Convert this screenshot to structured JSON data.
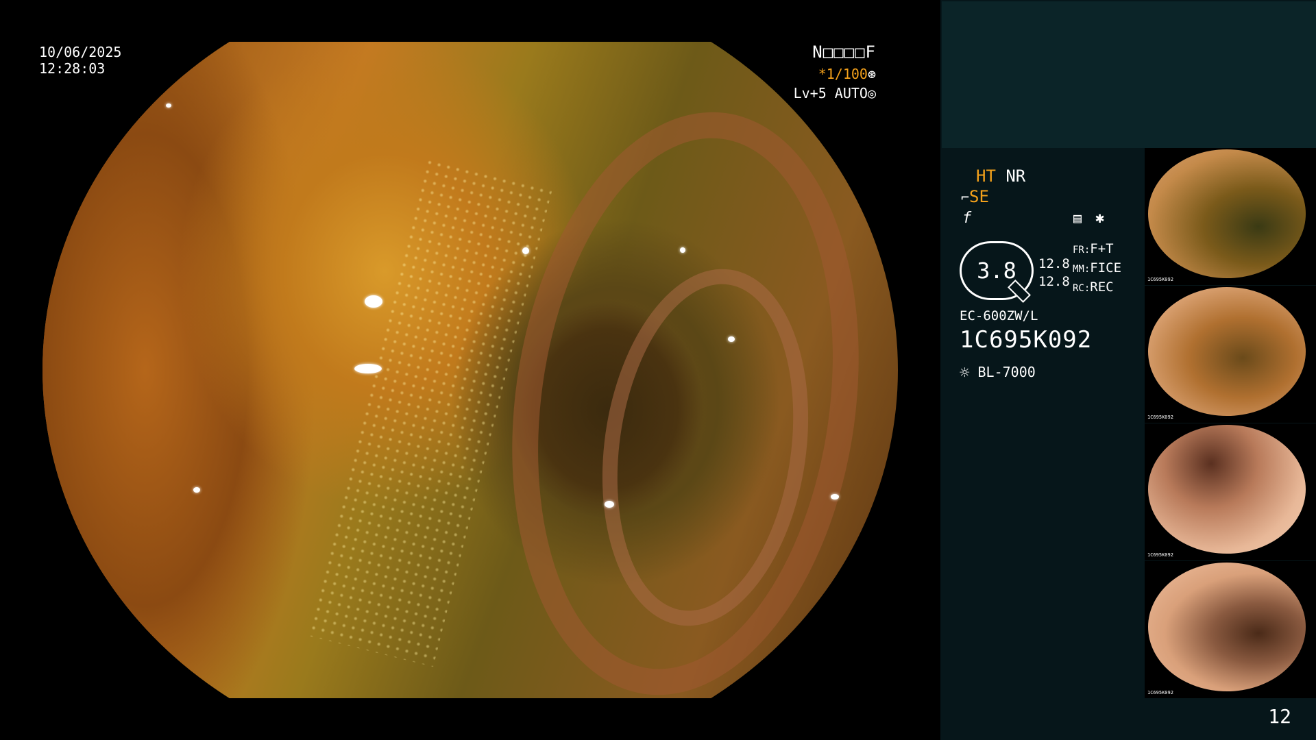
{
  "overlay": {
    "date": "10/06/2025",
    "time": "12:28:03",
    "patient_id": "N□□□□F",
    "shutter": "*1/100",
    "level": "Lv+5 AUTO"
  },
  "info": {
    "ht": "HT",
    "nr": "NR",
    "se": "SE",
    "zoom": "3.8",
    "value_1": "12.8",
    "value_2": "12.8",
    "fr_label": "FR:",
    "fr_value": "F+T",
    "mm_label": "MM:",
    "mm_value": "FICE",
    "rc_label": "RC:",
    "rc_value": "REC",
    "scope_model": "EC-600ZW/L",
    "scope_serial": "1C695K092",
    "light_source": "BL-7000"
  },
  "thumbnails": [
    {
      "caption": "1C695K092"
    },
    {
      "caption": "1C695K092"
    },
    {
      "caption": "1C695K092"
    },
    {
      "caption": "1C695K092"
    }
  ],
  "page_number": "12",
  "colors": {
    "accent_orange": "#f4a11b",
    "panel_bg": "#06161a",
    "panel_top_bg": "#0b2428"
  },
  "icons": {
    "shutter_icon": "aperture-icon",
    "auto_icon": "iris-icon",
    "se_icon": "structure-icon",
    "f_icon": "freeze-icon",
    "settings_icon": "settings-list-icon",
    "star_icon": "asterisk-icon",
    "light_icon": "light-source-icon"
  }
}
